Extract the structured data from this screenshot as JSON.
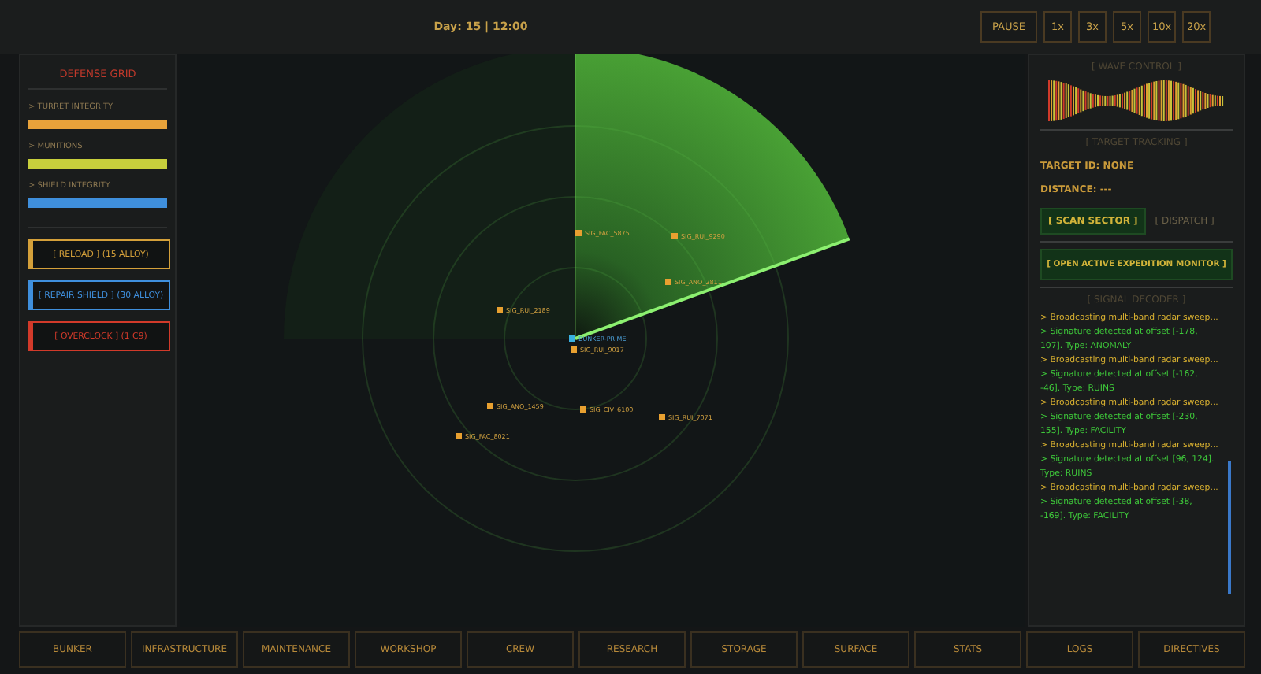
{
  "top_bar": {
    "clock": "Day: 15 | 12:00",
    "buttons": [
      "PAUSE",
      "1x",
      "3x",
      "5x",
      "10x",
      "20x"
    ]
  },
  "defense_grid": {
    "title": "DEFENSE GRID",
    "meters": [
      {
        "label": "> TURRET INTEGRITY",
        "level": 1,
        "color": "#e8a23a"
      },
      {
        "label": "> MUNITIONS",
        "level": 1,
        "color": "#c8cf3c"
      },
      {
        "label": "> SHIELD INTEGRITY",
        "level": 1,
        "color": "#3f8fdc"
      }
    ],
    "actions": [
      {
        "label": "[ RELOAD ] (15 ALLOY)",
        "color": "#d4a03a"
      },
      {
        "label": "[ REPAIR SHIELD ] (30 ALLOY)",
        "color": "#3f8fdc"
      },
      {
        "label": "[ OVERCLOCK ] (1 C9)",
        "color": "#d23a2a"
      }
    ]
  },
  "radar": {
    "contacts": [
      {
        "label": "SIG_FAC_5875",
        "kind": "signal"
      },
      {
        "label": "SIG_RUI_9290",
        "kind": "signal"
      },
      {
        "label": "SIG_ANO_2811",
        "kind": "signal"
      },
      {
        "label": "SIG_RUI_2189",
        "kind": "signal"
      },
      {
        "label": "BUNKER-PRIME",
        "kind": "base"
      },
      {
        "label": "SIG_RUI_9017",
        "kind": "signal"
      },
      {
        "label": "SIG_ANO_1459",
        "kind": "signal"
      },
      {
        "label": "SIG_CIV_6100",
        "kind": "signal"
      },
      {
        "label": "SIG_RUI_7071",
        "kind": "signal"
      },
      {
        "label": "SIG_FAC_8021",
        "kind": "signal"
      }
    ]
  },
  "wave_control": {
    "title": "[ WAVE CONTROL ]"
  },
  "target_tracking": {
    "title": "[ TARGET TRACKING ]",
    "target_id": "TARGET ID: NONE",
    "distance": "DISTANCE: ---",
    "scan_button": "[ SCAN SECTOR ]",
    "dispatch_button": {
      "label": "[ DISPATCH ]",
      "disabled": true
    },
    "monitor_button": "[ OPEN ACTIVE EXPEDITION MONITOR ]"
  },
  "signal_decoder": {
    "title": "[ SIGNAL DECODER ]",
    "log": [
      {
        "kind": "broadcast",
        "text": "> Broadcasting multi-band radar sweep..."
      },
      {
        "kind": "signature",
        "text": "> Signature detected at offset [-178, 107]. Type: ANOMALY"
      },
      {
        "kind": "broadcast",
        "text": "> Broadcasting multi-band radar sweep..."
      },
      {
        "kind": "signature",
        "text": "> Signature detected at offset [-162, -46]. Type: RUINS"
      },
      {
        "kind": "broadcast",
        "text": "> Broadcasting multi-band radar sweep..."
      },
      {
        "kind": "signature",
        "text": "> Signature detected at offset [-230, 155]. Type: FACILITY"
      },
      {
        "kind": "broadcast",
        "text": "> Broadcasting multi-band radar sweep..."
      },
      {
        "kind": "signature",
        "text": "> Signature detected at offset [96, 124]. Type: RUINS"
      },
      {
        "kind": "broadcast",
        "text": "> Broadcasting multi-band radar sweep..."
      },
      {
        "kind": "signature",
        "text": "> Signature detected at offset [-38, -169]. Type: FACILITY"
      }
    ]
  },
  "nav_tabs": [
    "BUNKER",
    "INFRASTRUCTURE",
    "MAINTENANCE",
    "WORKSHOP",
    "CREW",
    "RESEARCH",
    "STORAGE",
    "SURFACE",
    "STATS",
    "LOGS",
    "DIRECTIVES"
  ]
}
